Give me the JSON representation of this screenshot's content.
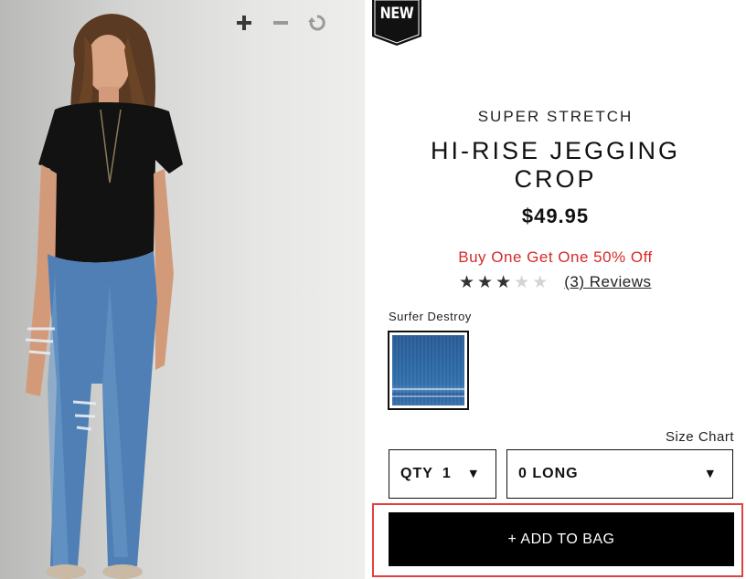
{
  "badge": {
    "text": "NEW"
  },
  "product": {
    "subtitle": "SUPER STRETCH",
    "title": "HI-RISE JEGGING CROP",
    "price": "$49.95",
    "promo": "Buy One Get One 50% Off",
    "rating": {
      "value": 3,
      "max": 5
    },
    "reviews_link": "(3) Reviews"
  },
  "color": {
    "name": "Surfer Destroy"
  },
  "size_chart_link": "Size Chart",
  "qty": {
    "label": "QTY",
    "value": "1"
  },
  "size": {
    "value": "0 LONG"
  },
  "add_to_bag_label": "+ ADD TO BAG",
  "icons": {
    "zoom_in": "plus-icon",
    "zoom_out": "minus-icon",
    "reset": "rotate-icon",
    "dropdown": "caret-down-icon"
  },
  "colors": {
    "promo": "#d72a2a",
    "star_filled": "#333333",
    "star_empty": "#d4d4d4",
    "button_bg": "#000000",
    "highlight": "#e2403f",
    "badge_bg": "#111111"
  }
}
